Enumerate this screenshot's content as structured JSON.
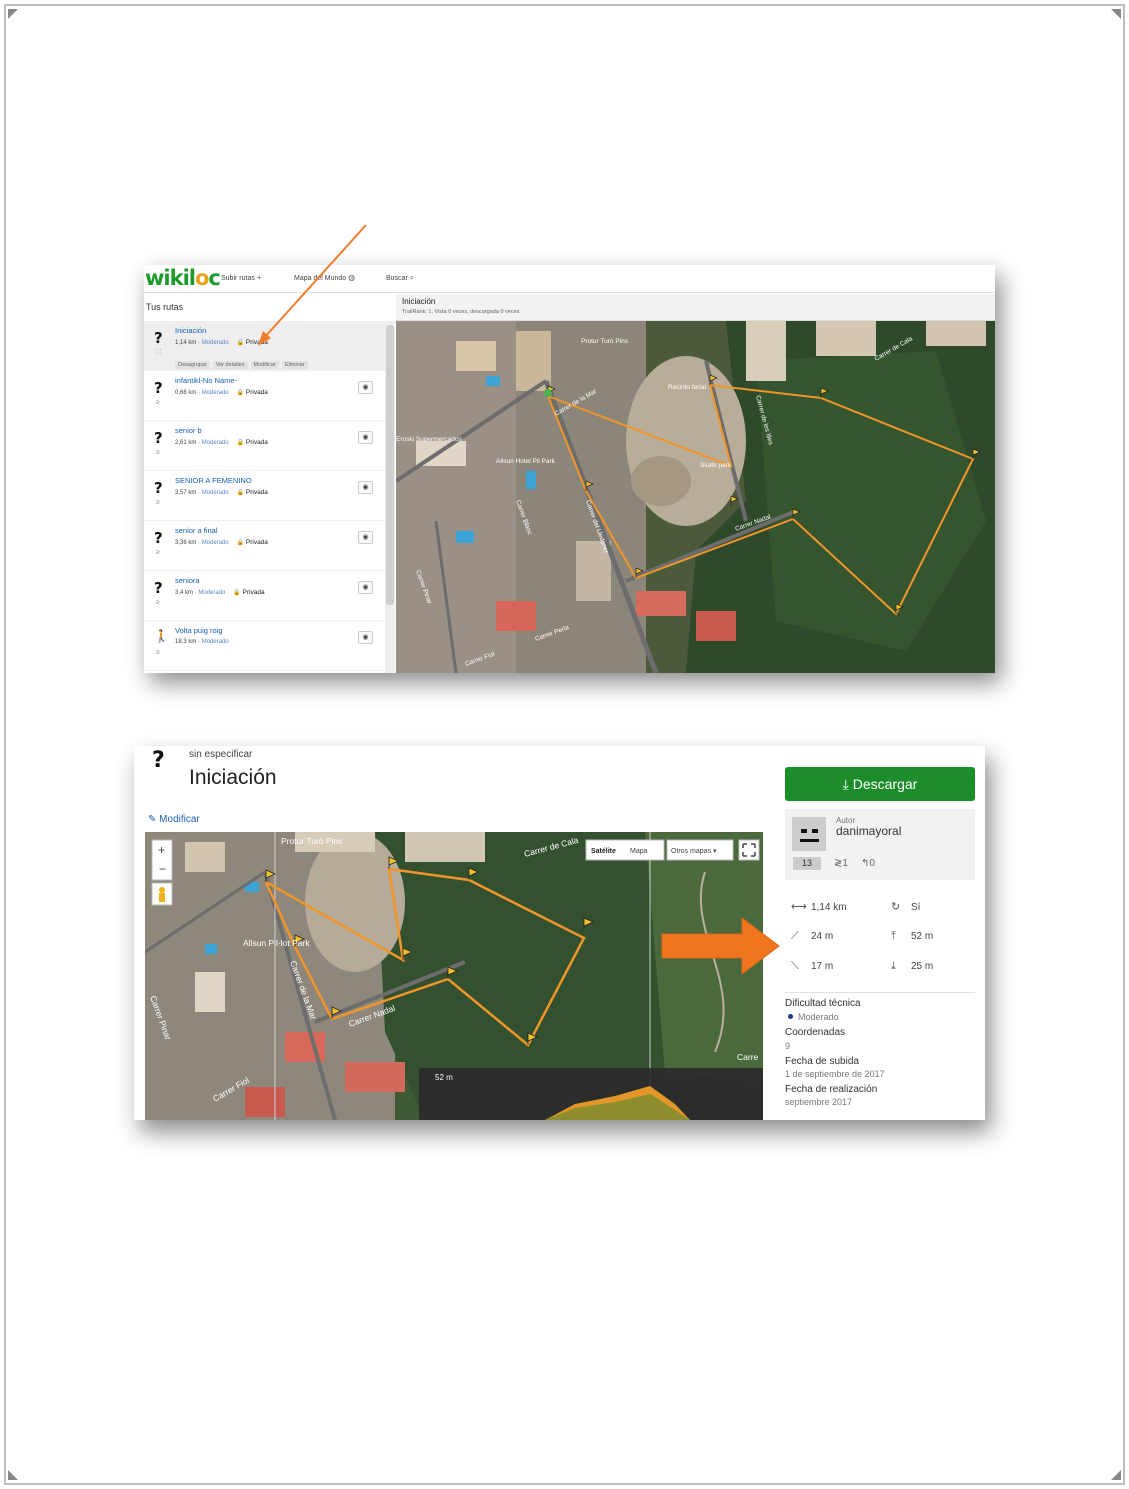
{
  "colors": {
    "accent": "#e7861f",
    "brand_green": "#1d9a2c",
    "link_blue": "#1a5fb4",
    "download_green": "#1d8d2c"
  },
  "shot1": {
    "logo_start": "wikil",
    "logo_o": "o",
    "logo_end": "c",
    "nav": [
      {
        "label": "Subir rutas",
        "icon": "+"
      },
      {
        "label": "Mapa del Mundo",
        "icon": "◍"
      },
      {
        "label": "Buscar",
        "icon": "⌕"
      }
    ],
    "sidebar_title": "Tus rutas",
    "map_title": "Iniciación",
    "map_subtitle": "TrailRank: 1. Vista 0 veces, descargada 0 veces",
    "routes": [
      {
        "name": "Iniciación",
        "distance": "1,14 km",
        "difficulty": "Moderado",
        "privacy": "Privada",
        "icon": "?"
      },
      {
        "name": "infantikl-No Name-",
        "distance": "0,68 km",
        "difficulty": "Moderado",
        "privacy": "Privada",
        "icon": "?"
      },
      {
        "name": "senior b",
        "distance": "2,61 km",
        "difficulty": "Moderado",
        "privacy": "Privada",
        "icon": "?"
      },
      {
        "name": "SENIOR A FEMENINO",
        "distance": "3,57 km",
        "difficulty": "Moderado",
        "privacy": "Privada",
        "icon": "?"
      },
      {
        "name": "senior a final",
        "distance": "3,36 km",
        "difficulty": "Moderado",
        "privacy": "Privada",
        "icon": "?"
      },
      {
        "name": "seniora",
        "distance": "3,4 km",
        "difficulty": "Moderado",
        "privacy": "Privada",
        "icon": "?"
      },
      {
        "name": "Volta puig roig",
        "distance": "18,3 km",
        "difficulty": "Moderado",
        "privacy": "",
        "icon": "🚶"
      }
    ],
    "actions": [
      "Desagrupar",
      "Ver detalles",
      "Modificar",
      "Eliminar"
    ],
    "map_labels": [
      "Protur Turó Pins",
      "Recinto ferial",
      "Carrer de Cala",
      "Carrer de les Illes",
      "Skate park",
      "Carrer Nadal",
      "Carrer de la Mar",
      "Eroski Supermercados",
      "Allsun Hotel Pil Park",
      "Carrer Blanc",
      "Carrer del Lledoner",
      "Carrer Pinar",
      "Carrer Perla",
      "Carrer Fiol"
    ]
  },
  "shot2": {
    "sub": "sin especificar",
    "title": "Iniciación",
    "icon": "?",
    "modify": "Modificar",
    "download": "Descargar",
    "author_label": "Autor",
    "author_name": "danimayoral",
    "author_count": "13",
    "author_stat_a": "1",
    "author_stat_b": "0",
    "map_buttons": [
      "Satélite",
      "Mapa",
      "Otros mapas ▾"
    ],
    "map_labels": [
      "Protur Turó Pins",
      "Allsun Pil·lot Park",
      "Carrer Nadal",
      "Carrer de la Mar",
      "Carrer Pinar",
      "Carrer de Cala",
      "Carre",
      "Carrer Fiol"
    ],
    "elevation_label": "52 m",
    "stats": {
      "distance": "1,14 km",
      "loop": "Sí",
      "up": "24 m",
      "max": "52 m",
      "down": "17 m",
      "min": "25 m"
    },
    "info": [
      {
        "label": "Dificultad técnica",
        "value": "Moderado"
      },
      {
        "label": "Coordenadas",
        "value": "9"
      },
      {
        "label": "Fecha de subida",
        "value": "1 de septiembre de 2017"
      },
      {
        "label": "Fecha de realización",
        "value": "septiembre 2017"
      }
    ]
  }
}
